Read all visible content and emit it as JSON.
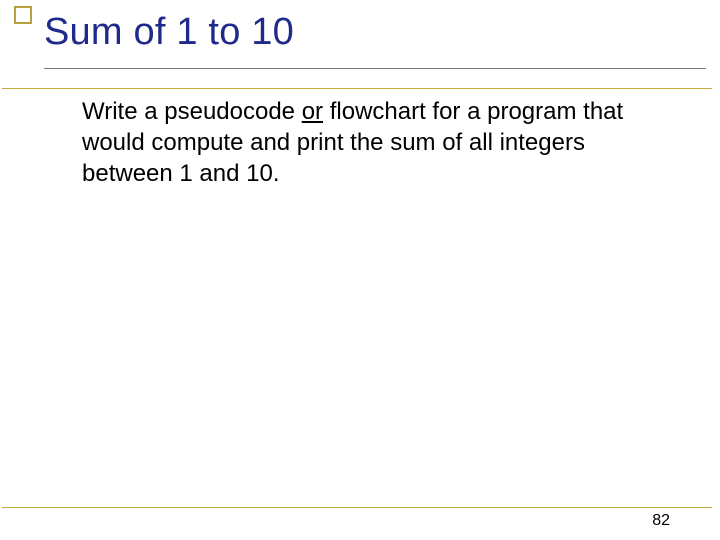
{
  "slide": {
    "title": "Sum of 1 to 10",
    "body_pre": "Write a pseudocode ",
    "body_underlined": "or",
    "body_post": " flowchart for a program that would compute and print the sum of all integers between 1 and 10.",
    "page_number": "82"
  }
}
